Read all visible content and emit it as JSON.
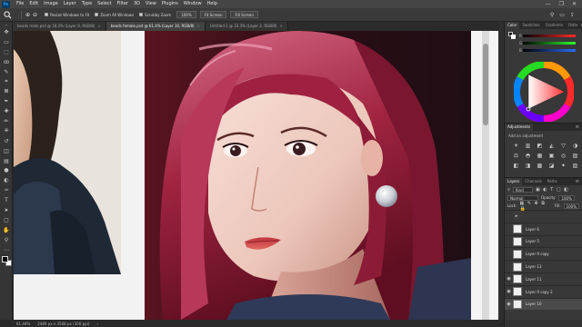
{
  "app": {
    "logo": "Ps"
  },
  "menu": [
    "File",
    "Edit",
    "Image",
    "Layer",
    "Type",
    "Select",
    "Filter",
    "3D",
    "View",
    "Plugins",
    "Window",
    "Help"
  ],
  "window_controls": {
    "minimize": "—",
    "maximize": "❐",
    "close": "✕"
  },
  "options_bar": {
    "tool_icon": "zoom-tool-icon",
    "resize_windows_label": "Resize Windows to Fit",
    "zoom_all_windows_label": "Zoom All Windows",
    "scrubby_zoom_label": "Scrubby Zoom",
    "zoom_value": "100%",
    "fit_screen_label": "Fit Screen",
    "fill_screen_label": "Fill Screen"
  },
  "tabs": [
    {
      "label": "beads mats.psd @ 18.2% (Layer 9, RGB/8)",
      "close": "×",
      "active": false
    },
    {
      "label": "beads female.psd @ 61.4% (Layer 10, RGB/8)",
      "close": "×",
      "active": true
    },
    {
      "label": "Untitled-1 @ 33.3% (Layer 2, RGB/8)",
      "close": "×",
      "active": false
    }
  ],
  "toolbar": {
    "icons": [
      "move-tool-icon",
      "artboard-tool-icon",
      "marquee-tool-icon",
      "lasso-tool-icon",
      "quick-select-tool-icon",
      "crop-tool-icon",
      "frame-tool-icon",
      "eyedropper-tool-icon",
      "healing-brush-icon",
      "brush-tool-icon",
      "clone-stamp-icon",
      "history-brush-icon",
      "eraser-tool-icon",
      "gradient-tool-icon",
      "blur-tool-icon",
      "dodge-tool-icon",
      "pen-tool-icon",
      "type-tool-icon",
      "path-select-icon",
      "shape-tool-icon",
      "hand-tool-icon",
      "zoom-tool-icon",
      "more-tools-icon"
    ],
    "glyphs": [
      "✥",
      "▭",
      "⬚",
      "ꝏ",
      "✎",
      "⌗",
      "⊠",
      "✒",
      "✚",
      "✏",
      "⎈",
      "↺",
      "◫",
      "▤",
      "●",
      "◐",
      "✑",
      "T",
      "➤",
      "▢",
      "✋",
      "⚲",
      "⋯"
    ]
  },
  "status": {
    "zoom": "61.44%",
    "doc_size": "2480 px x 3508 px (300 ppi)"
  },
  "panels": {
    "color_tabs": [
      {
        "label": "Color",
        "active": true
      },
      {
        "label": "Swatches",
        "active": false
      },
      {
        "label": "Gradients",
        "active": false
      },
      {
        "label": "Patte",
        "active": false
      }
    ],
    "slider_labels": [
      "R",
      "G",
      "B"
    ],
    "adjustments_tabs": [
      {
        "label": "Adjustments",
        "active": true
      }
    ],
    "adjustments_hint": "Add an adjustment",
    "adjustment_icons": [
      "☀",
      "▥",
      "◩",
      "◭",
      "▽",
      "◑",
      "⚖",
      "◓",
      "▦",
      "▣",
      "◎",
      "▨",
      "◧",
      "◨",
      "▩",
      "◪",
      "✦",
      "▧"
    ],
    "layers_tabs": [
      {
        "label": "Layers",
        "active": true
      },
      {
        "label": "Channels",
        "active": false
      },
      {
        "label": "Paths",
        "active": false
      }
    ],
    "layer_filter": "Kind",
    "blend_mode": "Normal",
    "opacity_label": "Opacity:",
    "opacity": "100%",
    "lock_label": "Lock:",
    "fill_label": "Fill:",
    "fill": "100%",
    "layers": [
      {
        "name": "",
        "visible": false,
        "selected": false,
        "group": true
      },
      {
        "name": "Layer 6",
        "visible": false,
        "selected": false,
        "group": false
      },
      {
        "name": "Layer 5",
        "visible": false,
        "selected": false,
        "group": false
      },
      {
        "name": "Layer 9 copy",
        "visible": false,
        "selected": false,
        "group": false
      },
      {
        "name": "Layer 13",
        "visible": false,
        "selected": false,
        "group": false
      },
      {
        "name": "Layer 11",
        "visible": true,
        "selected": false,
        "group": false
      },
      {
        "name": "Layer 9 copy 2",
        "visible": true,
        "selected": false,
        "group": false
      },
      {
        "name": "Layer 10",
        "visible": true,
        "selected": true,
        "group": false
      }
    ]
  }
}
